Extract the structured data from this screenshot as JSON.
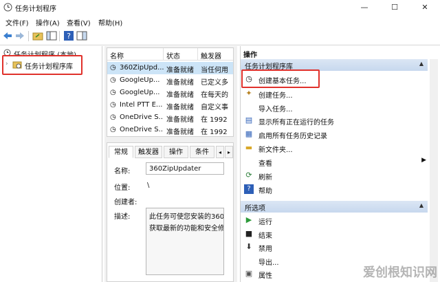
{
  "window": {
    "title": "任务计划程序",
    "controls": {
      "minimize": "—",
      "maximize": "☐",
      "close": "✕"
    }
  },
  "menu": [
    "文件(F)",
    "操作(A)",
    "查看(V)",
    "帮助(H)"
  ],
  "tree": {
    "root": "任务计划程序 (本地)",
    "library": "任务计划程序库"
  },
  "tasklist": {
    "columns": [
      "名称",
      "状态",
      "触发器"
    ],
    "rows": [
      {
        "name": "360ZipUpd...",
        "status": "准备就绪",
        "trigger": "当任何用"
      },
      {
        "name": "GoogleUp...",
        "status": "准备就绪",
        "trigger": "已定义多"
      },
      {
        "name": "GoogleUp...",
        "status": "准备就绪",
        "trigger": "在每天的"
      },
      {
        "name": "Intel PTT E...",
        "status": "准备就绪",
        "trigger": "自定义事"
      },
      {
        "name": "OneDrive S...",
        "status": "准备就绪",
        "trigger": "在 1992"
      },
      {
        "name": "OneDrive S...",
        "status": "准备就绪",
        "trigger": "在 1992"
      }
    ]
  },
  "detail": {
    "tabs": [
      "常规",
      "触发器",
      "操作",
      "条件"
    ],
    "name_label": "名称:",
    "name_value": "360ZipUpdater",
    "location_label": "位置:",
    "location_value": "\\",
    "author_label": "创建者:",
    "description_label": "描述:",
    "description_line1": "此任务可使您安装的360",
    "description_line2": "获取最新的功能和安全修"
  },
  "actions": {
    "header": "操作",
    "library_section": "任务计划程序库",
    "items": [
      {
        "label": "创建基本任务...",
        "icon": "basic-task-icon"
      },
      {
        "label": "创建任务...",
        "icon": "task-icon"
      },
      {
        "label": "导入任务...",
        "icon": "none"
      },
      {
        "label": "显示所有正在运行的任务",
        "icon": "running-tasks-icon"
      },
      {
        "label": "启用所有任务历史记录",
        "icon": "history-icon"
      },
      {
        "label": "新文件夹...",
        "icon": "folder-icon"
      },
      {
        "label": "查看",
        "icon": "none"
      },
      {
        "label": "刷新",
        "icon": "refresh-icon"
      },
      {
        "label": "帮助",
        "icon": "help-icon"
      }
    ],
    "selected_section": "所选项",
    "selected_items": [
      {
        "label": "运行",
        "icon": "run-icon"
      },
      {
        "label": "结束",
        "icon": "stop-icon"
      },
      {
        "label": "禁用",
        "icon": "disable-icon"
      },
      {
        "label": "导出...",
        "icon": "none"
      },
      {
        "label": "属性",
        "icon": "properties-icon"
      }
    ]
  },
  "watermark": "爱创根知识网",
  "colors": {
    "highlight": "#e0302a",
    "section_bg": "#cfdcef",
    "selected_row": "#cce4f7"
  }
}
